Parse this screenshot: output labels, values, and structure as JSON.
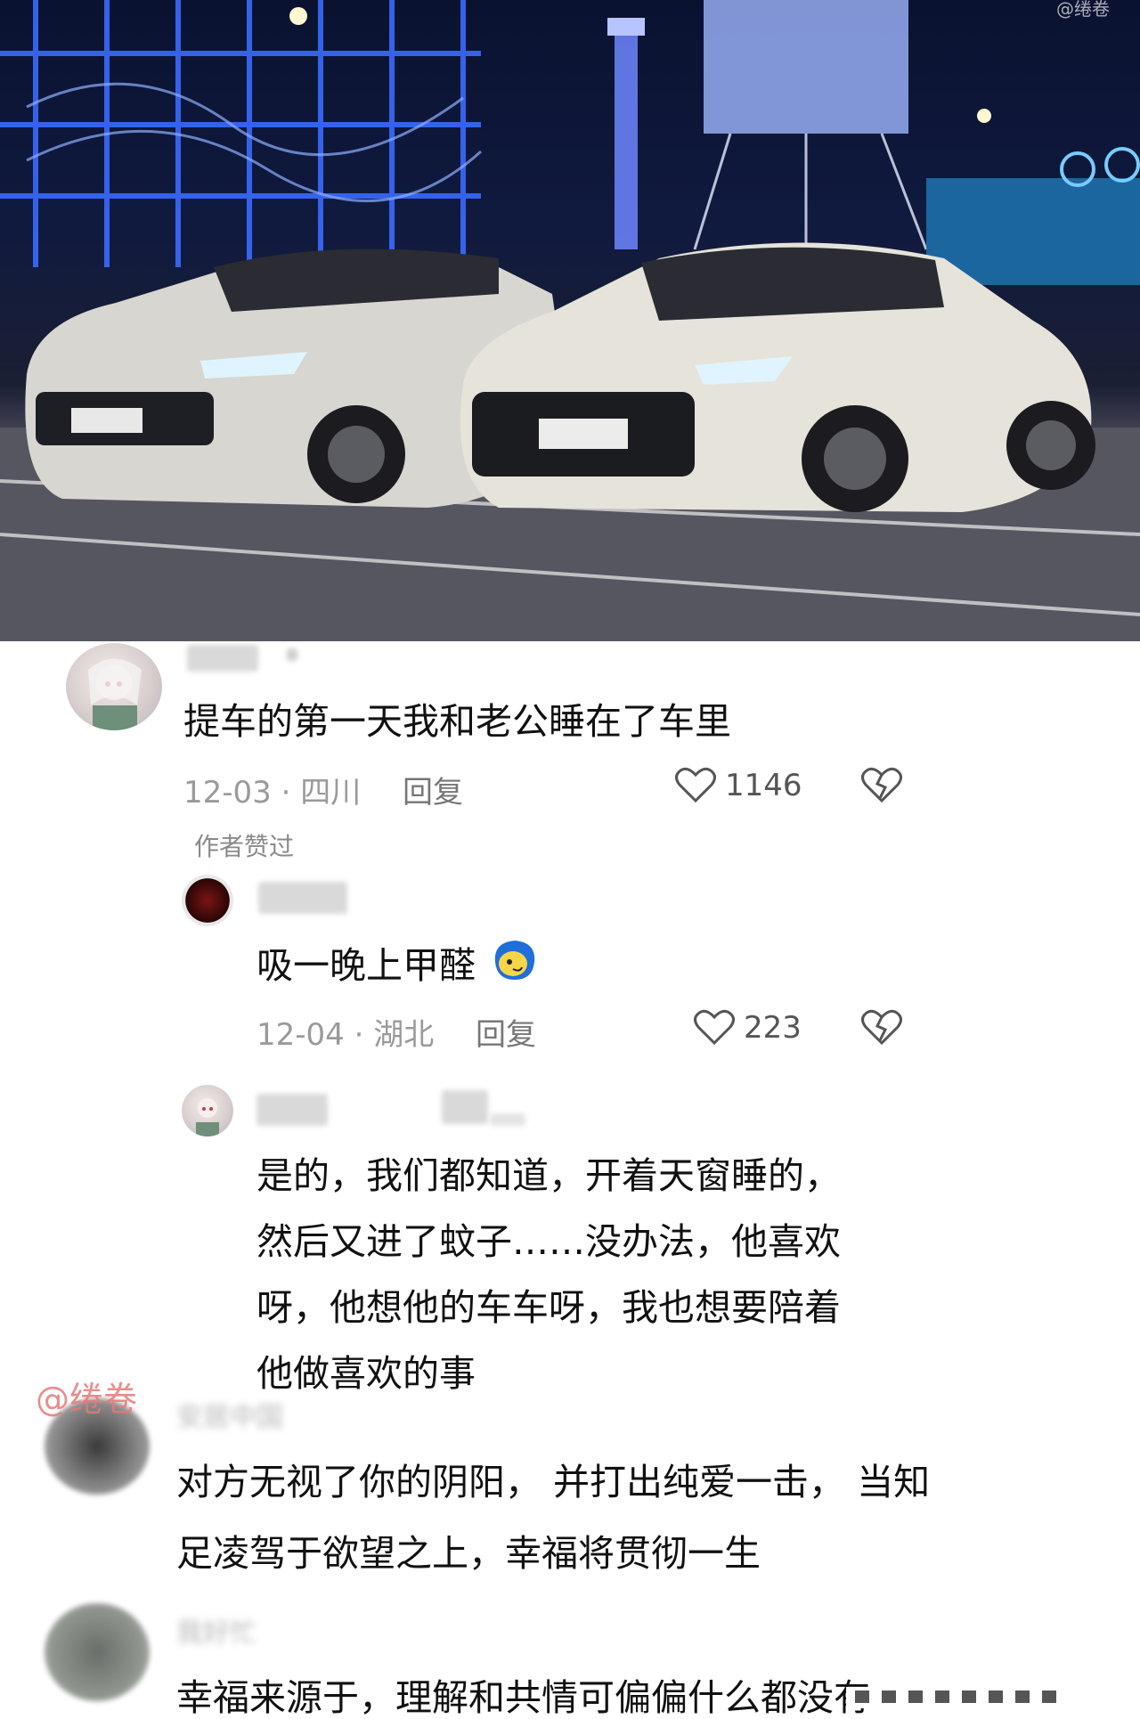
{
  "hero": {
    "watermark": "@绻卷",
    "description_icon": "photo"
  },
  "comments": [
    {
      "id": "c1",
      "text": "提车的第一天我和老公睡在了车里",
      "date": "12-03",
      "location": "四川",
      "date_location": "12-03 · 四川",
      "reply_label": "回复",
      "likes": "1146",
      "author_liked": "作者赞过"
    },
    {
      "id": "c2",
      "text": "吸一晚上甲醛",
      "emoji": "face-icon",
      "date_location": "12-04 · 湖北",
      "reply_label": "回复",
      "likes": "223"
    },
    {
      "id": "c3",
      "lines": [
        "是的，我们都知道，开着天窗睡的，",
        "然后又进了蚊子……没办法，他喜欢",
        "呀，他想他的车车呀，我也想要陪着",
        "他做喜欢的事"
      ]
    },
    {
      "id": "c4",
      "name": "安居中国",
      "handle": "@绻卷",
      "lines": [
        "对方无视了你的阴阳，  并打出纯爱一击，   当知",
        "足凌驾于欲望之上，幸福将贯彻一生"
      ]
    },
    {
      "id": "c5",
      "name": "我好忙",
      "lines": [
        "幸福来源于，理解和共情可偏偏什么都没有"
      ]
    }
  ],
  "colors": {
    "text": "#111111",
    "meta": "#9a9a9a",
    "accent_watermark": "#e67878"
  }
}
